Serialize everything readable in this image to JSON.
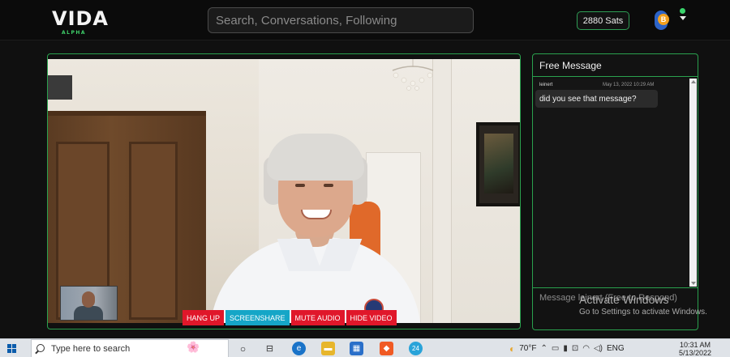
{
  "app": {
    "logo": "VIDA",
    "logo_sub": "ALPHA",
    "search_placeholder": "Search, Conversations, Following",
    "sats": "2880 Sats",
    "avatar_symbol": "B"
  },
  "call": {
    "controls": {
      "hang_up": "HANG UP",
      "screenshare": "SCREENSHARE",
      "mute_audio": "MUTE AUDIO",
      "hide_video": "HIDE VIDEO"
    }
  },
  "chat": {
    "title": "Free Message",
    "messages": [
      {
        "user": "leinert",
        "time": "May 13, 2022 10:29 AM",
        "text": "did you see that message?"
      }
    ],
    "input_placeholder": "Message leinert (Free to Respond)"
  },
  "watermark": {
    "title": "Activate Windows",
    "subtitle": "Go to Settings to activate Windows."
  },
  "taskbar": {
    "search_placeholder": "Type here to search",
    "weather": "70°F",
    "language": "ENG",
    "time": "10:31 AM",
    "date": "5/13/2022",
    "badge_count": "24"
  },
  "colors": {
    "accent_green": "#2aa14e",
    "hang_up": "#e0172a",
    "screenshare": "#15a6c7"
  }
}
